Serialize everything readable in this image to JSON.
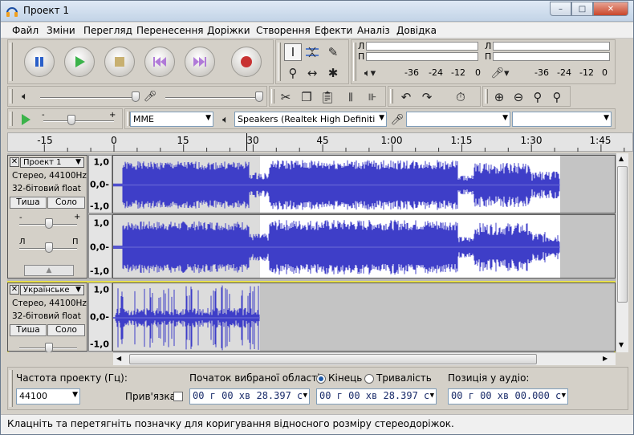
{
  "window": {
    "title": "Проект 1",
    "controls": {
      "minimize": "–",
      "maximize": "□",
      "close": "✕"
    }
  },
  "menu": [
    "Файл",
    "Зміни",
    "Перегляд",
    "Перенесення",
    "Доріжки",
    "Створення",
    "Ефекти",
    "Аналіз",
    "Довідка"
  ],
  "meters": {
    "channel_l": "Л",
    "channel_r": "П",
    "scale": [
      "-36",
      "-24",
      "-12",
      "0"
    ]
  },
  "device": {
    "host": "MME",
    "output": "Speakers (Realtek High Definiti",
    "input": "",
    "channels": ""
  },
  "ruler": {
    "labels": [
      "-15",
      "0",
      "15",
      "30",
      "45",
      "1:00",
      "1:15",
      "1:30",
      "1:45"
    ]
  },
  "tracks": [
    {
      "name": "Проект 1",
      "info1": "Стерео, 44100Hz",
      "info2": "32-бітовий float",
      "mute": "Тиша",
      "solo": "Соло",
      "gain_minus": "-",
      "gain_plus": "+",
      "pan_left": "Л",
      "pan_right": "П",
      "vscale": [
        "1,0",
        "0,0-",
        "-1,0"
      ]
    },
    {
      "name": "Українське",
      "info1": "Стерео, 44100Hz",
      "info2": "32-бітовий float",
      "mute": "Тиша",
      "solo": "Соло",
      "vscale": [
        "1,0",
        "0,0-",
        "-1,0"
      ]
    }
  ],
  "selection": {
    "rate_label": "Частота проекту (Гц):",
    "rate_value": "44100",
    "snap_label": "Прив'язка",
    "start_label": "Початок вибраної області:",
    "end_label": "Кінець",
    "length_label": "Тривалість",
    "start_value": "00 г 00 хв 28.397 с",
    "end_value": "00 г 00 хв 28.397 с",
    "pos_label": "Позиція у аудіо:",
    "pos_value": "00 г 00 хв 00.000 с"
  },
  "status": "Клацніть та перетягніть позначку для коригування відносного розміру стереодоріжок.",
  "colors": {
    "wave": "#3e3ec8",
    "wave_light": "#6d6dd8",
    "selected_border": "#e8e04a"
  }
}
